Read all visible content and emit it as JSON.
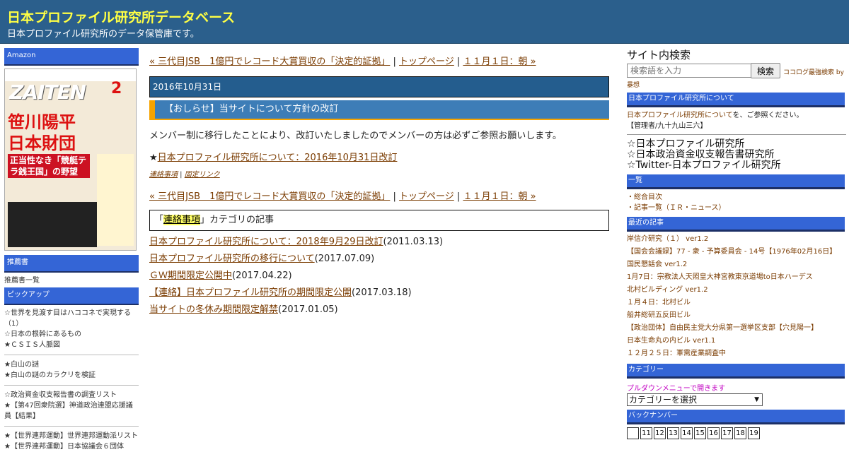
{
  "header": {
    "title": "日本プロファイル研究所データベース",
    "description": "日本プロファイル研究所のデータ保管庫です。"
  },
  "left": {
    "amazon_label": "Amazon",
    "ad": {
      "logo": "ZAITEN",
      "issue": "2",
      "headline_1": "笹川陽平",
      "headline_2": "日本財団",
      "sub": "正当性なき「競艇テラ銭王国」の野望"
    },
    "recommend_label": "推薦書",
    "recommend_link": "推薦書一覧",
    "pickup_label": "ピックアップ",
    "pickup_groups": [
      [
        "☆世界を見渡す目はハココネで実現する（1）",
        "☆日本の根幹にあるもの",
        "★ＣＳＩＳ人脈図"
      ],
      [
        "★白山の謎",
        "★白山の謎のカラクリを検証"
      ],
      [
        "☆政治資金収支報告書の調査リスト",
        "★【第47回衆院選】神道政治連盟応援議員【結果】"
      ],
      [
        "★【世界連邦運動】世界連邦運動派リスト",
        "★【世界連邦運動】日本協議会６団体"
      ]
    ]
  },
  "main": {
    "nav_prev": "« 三代目JSB　1億円でレコード大賞買収の「決定的証拠」",
    "nav_sep": " | ",
    "nav_top": "トップページ",
    "nav_next": "１１月１日：朝 »",
    "date": "2016年10月31日",
    "entry_title": "【おしらせ】当サイトについて方針の改訂",
    "body": "メンバー制に移行したことにより、改訂いたしましたのでメンバーの方は必ずご参照お願いします。",
    "star": "★",
    "star_link": "日本プロファイル研究所について：2016年10月31日改訂",
    "meta_cat": "連絡事項",
    "meta_sep": " | ",
    "meta_perma": "固定リンク",
    "cat_prefix": "「",
    "cat_name": "連絡事項",
    "cat_suffix": "」カテゴリの記事",
    "articles": [
      {
        "title": "日本プロファイル研究所について：2018年9月29日改訂",
        "date": "(2011.03.13)"
      },
      {
        "title": "日本プロファイル研究所の移行について",
        "date": "(2017.07.09)"
      },
      {
        "title": "ＧＷ期間限定公開中",
        "date": "(2017.04.22)"
      },
      {
        "title": "【連絡】日本プロファイル研究所の期間限定公開",
        "date": "(2017.03.18)"
      },
      {
        "title": "当サイトの冬休み期間限定解禁",
        "date": "(2017.01.05)"
      }
    ]
  },
  "right": {
    "search_title": "サイト内検索",
    "search_placeholder": "検索語を入力",
    "search_button": "検索",
    "coco_text": "ココログ最強検索 by",
    "coco_text2": "暴想",
    "about_label": "日本プロファイル研究所について",
    "about_link": "日本プロファイル研究所について",
    "about_suffix": "を、ご参照ください。",
    "admin": "【管理者/九十九山三六】",
    "big_links": [
      "☆日本プロファイル研究所",
      "☆日本政治資金収支報告書研究所",
      "☆Twitter-日本プロファイル研究所"
    ],
    "list_label": "一覧",
    "list_items": [
      "総合目次",
      "記事一覧（ＩＲ・ニュース）"
    ],
    "recent_label": "最近の記事",
    "recent_items": [
      "岸信介研究（１） ver1.2",
      "【国会会議録】77 - 衆 - 予算委員会 - 14号【1976年02月16日】",
      "国民懇話会 ver1.2",
      "1月7日：宗教法人天照皇大神宮教東京道場to日本ハーデス",
      "北村ビルディング ver1.2",
      "１月４日：北村ビル",
      "船井総研五反田ビル",
      "【政治団体】自由民主党大分県第一選挙区支部【穴見陽一】",
      "日本生命丸の内ビル ver1.1",
      "１２月２５日：軍需産業調査中"
    ],
    "category_label": "カテゴリー",
    "category_hint": "プルダウンメニューで開きます",
    "category_select": "カテゴリーを選択",
    "backnumber_label": "バックナンバー",
    "backnumbers": [
      "",
      "11",
      "12",
      "13",
      "14",
      "15",
      "16",
      "17",
      "18",
      "19"
    ]
  }
}
